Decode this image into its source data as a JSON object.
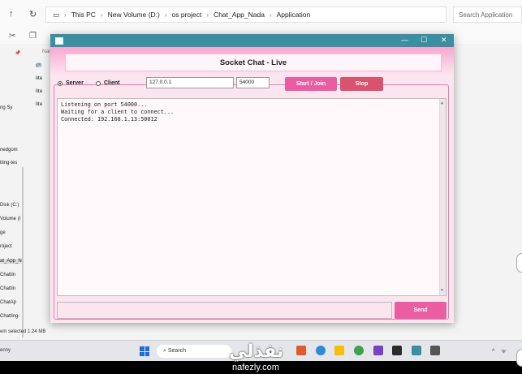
{
  "explorer": {
    "breadcrumb": [
      "This PC",
      "New Volume (D:)",
      "os project",
      "Chat_App_Nada",
      "Application"
    ],
    "search_placeholder": "Search Application",
    "column_header": "Nam",
    "files": [
      "ch",
      "lite",
      "lite",
      "lite"
    ],
    "nav_items": [
      "ng Sy",
      "nedgom",
      "tting-tes",
      "Disk (C:)",
      "Volume (I",
      "ge",
      "roject",
      "at_App_N",
      "Chattin",
      "Chattin",
      "ChatAp",
      "Chatting-"
    ],
    "status": "em selected  1.24 MB"
  },
  "taskbar": {
    "left_text": "enny",
    "search_label": "Search"
  },
  "watermark": {
    "arabic": "نفذلي",
    "site": "nafezly.com"
  },
  "app": {
    "title": "Socket Chat - Live",
    "mode": {
      "server_label": "Server",
      "client_label": "Client",
      "selected": "Server"
    },
    "ip_value": "127.0.0.1",
    "port_value": "54000",
    "start_label": "Start / Join",
    "stop_label": "Stop",
    "log_lines": [
      "Listening on port 54000...",
      "Waiting for a client to connect...",
      "Connected: 192.168.1.13:50012"
    ],
    "message_value": "",
    "send_label": "Send"
  },
  "colors": {
    "titlebar": "#3b8fa0",
    "accent_pink": "#e95ea3",
    "stop_red": "#d9536e",
    "background": "#fbe5ef"
  }
}
